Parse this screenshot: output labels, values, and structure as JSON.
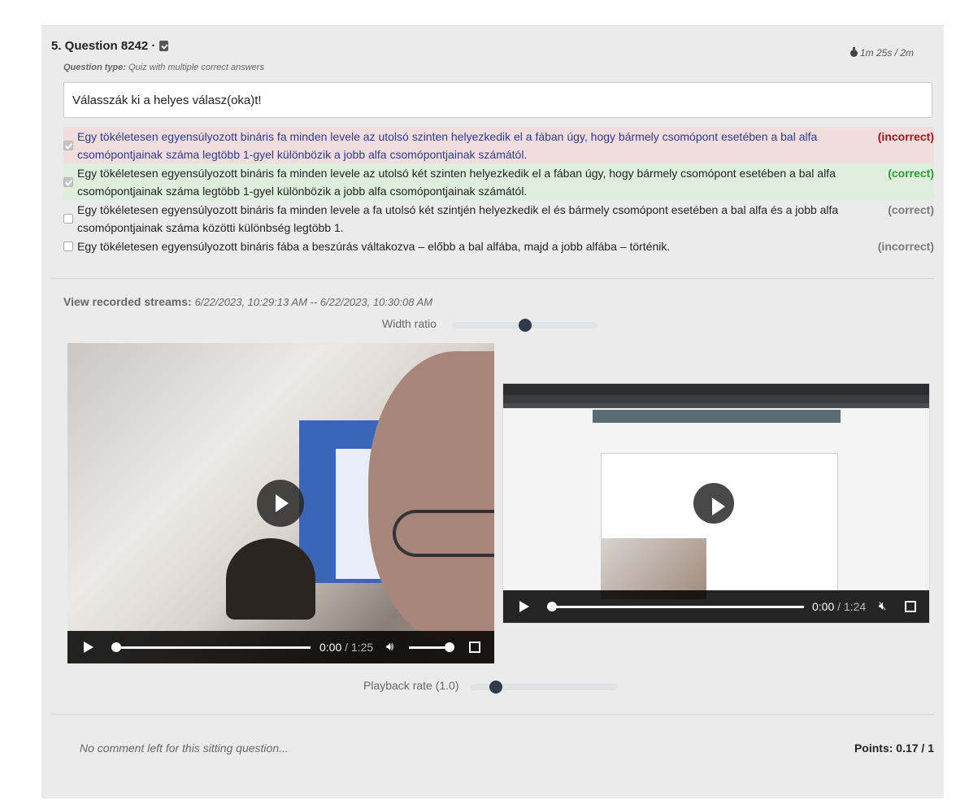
{
  "question": {
    "number_title": "5. Question 8242 ·",
    "timer": "1m 25s / 2m",
    "type_label": "Question type:",
    "type_value": "Quiz with multiple correct answers",
    "prompt": "Válasszák ki a helyes válasz(oka)t!"
  },
  "answers": [
    {
      "text": "Egy tökéletesen egyensúlyozott bináris fa minden levele az utolsó szinten helyezkedik el a fában úgy, hogy bármely csomópont esetében a bal alfa csomópontjainak száma legtöbb 1-gyel különbözik a jobb alfa csomópontjainak számától.",
      "result": "(incorrect)",
      "checked": true,
      "highlight": "red"
    },
    {
      "text": "Egy tökéletesen egyensúlyozott bináris fa minden levele az utolsó két szinten helyezkedik el a fában úgy, hogy bármely csomópont esetében a bal alfa csomópontjainak száma legtöbb 1-gyel különbözik a jobb alfa csomópontjainak számától.",
      "result": "(correct)",
      "checked": true,
      "highlight": "green"
    },
    {
      "text": "Egy tökéletesen egyensúlyozott bináris fa minden levele a fa utolsó két szintjén helyezkedik el és bármely csomópont esetében a bal alfa és a jobb alfa csomópontjainak száma közötti különbség legtöbb 1.",
      "result": "(correct)",
      "checked": false,
      "highlight": "none"
    },
    {
      "text": "Egy tökéletesen egyensúlyozott bináris fába a beszúrás váltakozva – előbb a bal alfába, majd a jobb alfába – történik.",
      "result": "(incorrect)",
      "checked": false,
      "highlight": "none"
    }
  ],
  "streams": {
    "label": "View recorded streams:",
    "range": "6/22/2023, 10:29:13 AM -- 6/22/2023, 10:30:08 AM",
    "width_ratio_label": "Width ratio",
    "width_ratio_value": 0.5,
    "playback_label": "Playback rate (1.0)",
    "playback_value": 0.17
  },
  "video_webcam": {
    "current": "0:00",
    "separator": " / ",
    "duration": "1:25",
    "progress": 0,
    "volume": 1.0
  },
  "video_screen": {
    "current": "0:00",
    "separator": " / ",
    "duration": "1:24",
    "progress": 0
  },
  "footer": {
    "comment": "No comment left for this sitting question...",
    "points": "Points: 0.17 / 1"
  },
  "colors": {
    "incorrect": "#a31515",
    "correct": "#2e9a2e",
    "incorrect_bg": "#f1dddd",
    "correct_bg": "#deeedd"
  }
}
